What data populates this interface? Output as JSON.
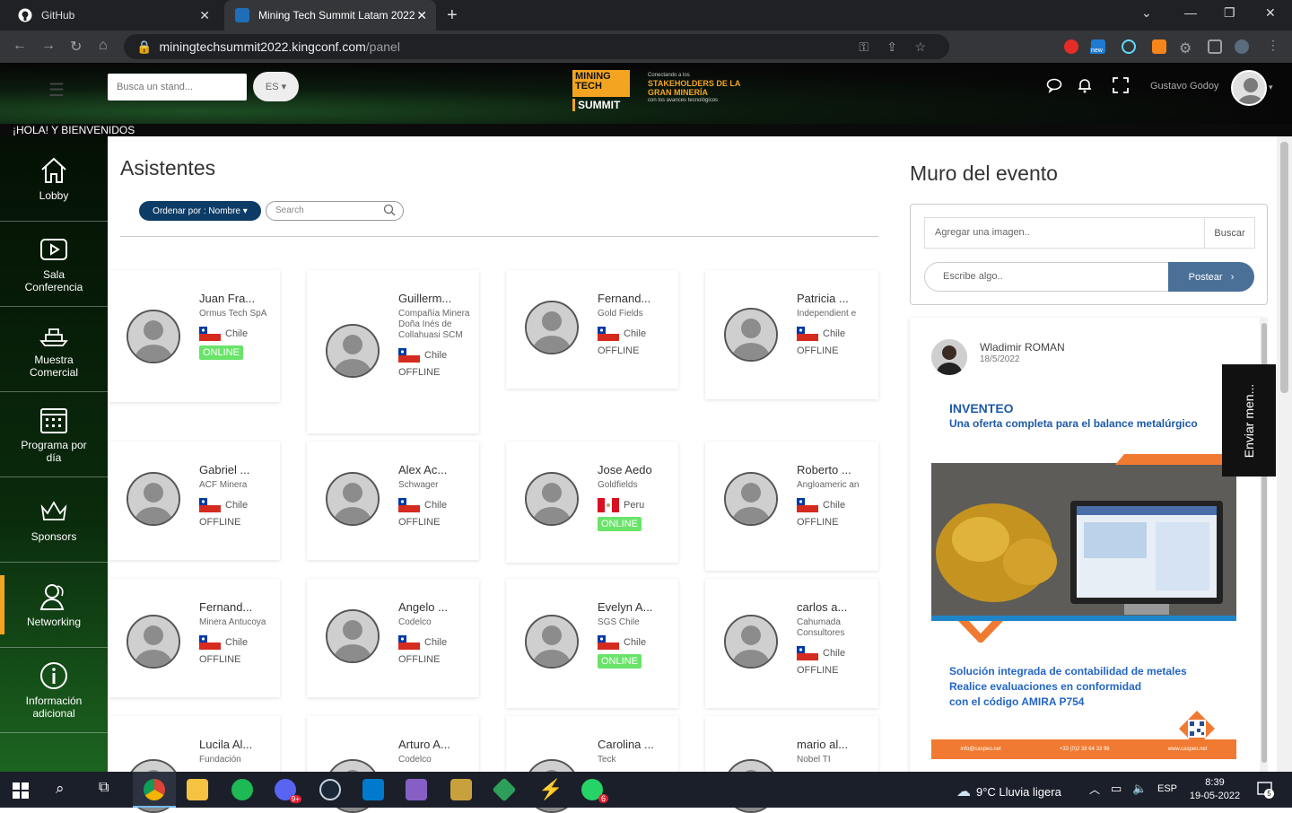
{
  "browser": {
    "tabs": [
      {
        "title": "GitHub",
        "active": false
      },
      {
        "title": "Mining Tech Summit Latam 2022",
        "active": true
      }
    ],
    "url_host": "miningtechsummit2022.kingconf.com",
    "url_path": "/panel",
    "ext_badge": "new"
  },
  "header": {
    "stand_search_placeholder": "Busca un stand...",
    "language": "ES",
    "logo_line1": "MINING TECH",
    "logo_line2": "SUMMIT",
    "tagline_small": "Conectando a los",
    "tagline_big": "STAKEHOLDERS DE LA GRAN MINERÍA",
    "tagline_bottom": "con los avances tecnológicos",
    "username": "Gustavo Godoy",
    "welcome": "¡HOLA!  Y BIENVENIDOS"
  },
  "sidebar": {
    "items": [
      {
        "label": "Lobby",
        "icon": "home-icon",
        "active": false
      },
      {
        "label": "Sala Conferencia",
        "icon": "play-icon",
        "active": false
      },
      {
        "label": "Muestra Comercial",
        "icon": "ship-icon",
        "active": false
      },
      {
        "label": "Programa por día",
        "icon": "calendar-icon",
        "active": false
      },
      {
        "label": "Sponsors",
        "icon": "crown-icon",
        "active": false
      },
      {
        "label": "Networking",
        "icon": "users-icon",
        "active": true
      },
      {
        "label": "Información adicional",
        "icon": "info-icon",
        "active": false
      }
    ]
  },
  "main": {
    "title": "Asistentes",
    "sort_label": "Ordenar por : Nombre",
    "search_placeholder": "Search",
    "attendees": [
      {
        "name": "Juan Fra...",
        "company": "Ormus Tech SpA",
        "country": "Chile",
        "status": "ONLINE"
      },
      {
        "name": "Guillerm...",
        "company": "Compañía Minera Doña Inés de Collahuasi SCM",
        "country": "Chile",
        "status": "OFFLINE"
      },
      {
        "name": "Fernand...",
        "company": "Gold Fields",
        "country": "Chile",
        "status": "OFFLINE"
      },
      {
        "name": "Patricia ...",
        "company": "Independient e",
        "country": "Chile",
        "status": "OFFLINE"
      },
      {
        "name": "Gabriel ...",
        "company": "ACF Minera",
        "country": "Chile",
        "status": "OFFLINE"
      },
      {
        "name": "Alex Ac...",
        "company": "Schwager",
        "country": "Chile",
        "status": "OFFLINE"
      },
      {
        "name": "Jose Aedo",
        "company": "Goldfields",
        "country": "Peru",
        "status": "ONLINE"
      },
      {
        "name": "Roberto ...",
        "company": "Angloameric an",
        "country": "Chile",
        "status": "OFFLINE"
      },
      {
        "name": "Fernand...",
        "company": "Minera Antucoya",
        "country": "Chile",
        "status": "OFFLINE"
      },
      {
        "name": "Angelo ...",
        "company": "Codelco",
        "country": "Chile",
        "status": "OFFLINE"
      },
      {
        "name": "Evelyn A...",
        "company": "SGS Chile",
        "country": "Chile",
        "status": "ONLINE"
      },
      {
        "name": "carlos a...",
        "company": "Cahumada Consultores",
        "country": "Chile",
        "status": "OFFLINE"
      },
      {
        "name": "Lucila Al...",
        "company": "Fundación",
        "country": "",
        "status": ""
      },
      {
        "name": "Arturo A...",
        "company": "Codelco",
        "country": "",
        "status": ""
      },
      {
        "name": "Carolina ...",
        "company": "Teck",
        "country": "",
        "status": ""
      },
      {
        "name": "mario al...",
        "company": "Nobel TI",
        "country": "",
        "status": ""
      }
    ]
  },
  "wall": {
    "title": "Muro del evento",
    "image_placeholder": "Agregar una imagen..",
    "browse_label": "Buscar",
    "post_placeholder": "Escribe algo..",
    "post_label": "Postear",
    "post": {
      "author": "Wladimir ROMAN",
      "date": "18/5/2022",
      "ad_brand": "INVENTEO",
      "ad_subtitle": "Una oferta completa para el balance metalúrgico",
      "ad_line1": "Solución integrada de contabilidad de metales",
      "ad_line2": "Realice evaluaciones en conformidad",
      "ad_line3": "con el código AMIRA P754",
      "footer_email": "info@caspeo.net",
      "footer_phone": "+33 (0)2 38 64 33 96",
      "footer_web": "www.caspeo.net"
    },
    "send_message_label": "Enviar men..."
  },
  "taskbar": {
    "weather": "9°C  Lluvia ligera",
    "lang": "ESP",
    "time": "8:39",
    "date": "19-05-2022",
    "discord_badge": "9+",
    "whatsapp_badge": "6",
    "notif_count": "5"
  },
  "colors": {
    "accent": "#f3a521",
    "primary": "#0d3d67",
    "online": "#69e469",
    "post_button": "#4a7098"
  }
}
